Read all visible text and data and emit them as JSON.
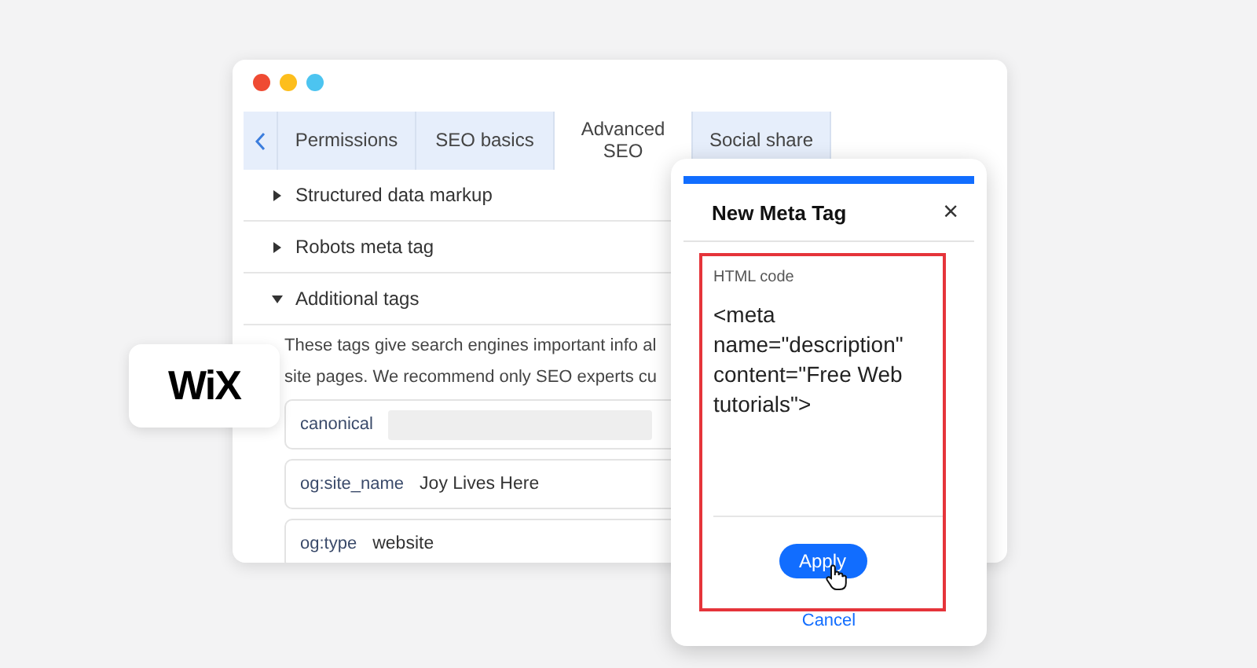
{
  "window": {
    "tabs": [
      {
        "label": "Permissions",
        "selected": false
      },
      {
        "label": "SEO basics",
        "selected": false
      },
      {
        "label": "Advanced SEO",
        "selected": true
      },
      {
        "label": "Social share",
        "selected": false
      }
    ],
    "sections": [
      {
        "title": "Structured data markup",
        "expanded": false
      },
      {
        "title": "Robots meta tag",
        "expanded": false
      },
      {
        "title": "Additional tags",
        "expanded": true
      }
    ],
    "description_lines": [
      "These tags give search engines important info al",
      "site pages. We recommend only SEO experts cu"
    ],
    "tags": [
      {
        "name": "canonical"
      },
      {
        "name": "og:site_name",
        "value": "Joy Lives Here"
      },
      {
        "name": "og:type",
        "value": "website"
      }
    ]
  },
  "logo": "WiX",
  "dialog": {
    "title": "New Meta Tag",
    "close": "×",
    "field_label": "HTML code",
    "value": "<meta\nname=\"description\"\ncontent=\"Free Web\ntutorials\">",
    "apply": "Apply",
    "cancel": "Cancel"
  }
}
